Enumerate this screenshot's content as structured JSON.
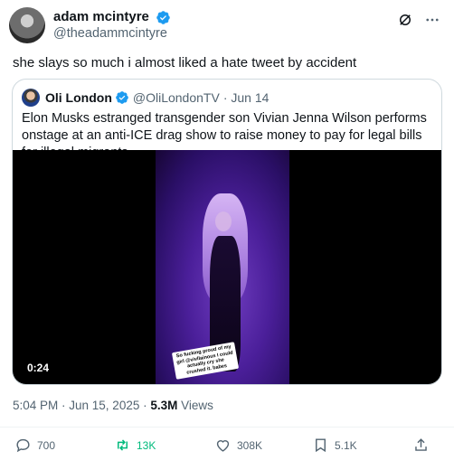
{
  "author": {
    "name": "adam mcintyre",
    "handle": "@theadammcintyre"
  },
  "tweet_text": "she slays so much i almost liked a hate tweet by accident",
  "quoted": {
    "name": "Oli London",
    "handle": "@OliLondonTV",
    "date": "· Jun 14",
    "text": "Elon Musks estranged transgender son Vivian Jenna Wilson performs onstage at an anti-ICE drag show to raise money to pay for legal bills for illegal migrants.",
    "video_duration": "0:24",
    "video_sticker": "So fucking proud of my girl @vivllainous I could actually cry she crushed it. babes"
  },
  "meta": {
    "timestamp": "5:04 PM · Jun 15, 2025 · ",
    "views_count": "5.3M",
    "views_label": " Views"
  },
  "actions": {
    "replies": "700",
    "reposts": "13K",
    "likes": "308K",
    "bookmarks": "5.1K"
  },
  "colors": {
    "verified": "#1d9bf0",
    "repost_active": "#00ba7c",
    "secondary_text": "#536471"
  },
  "icons": [
    "verified-badge-icon",
    "grok-icon",
    "more-icon",
    "reply-icon",
    "repost-icon",
    "like-icon",
    "bookmark-icon",
    "share-icon"
  ]
}
